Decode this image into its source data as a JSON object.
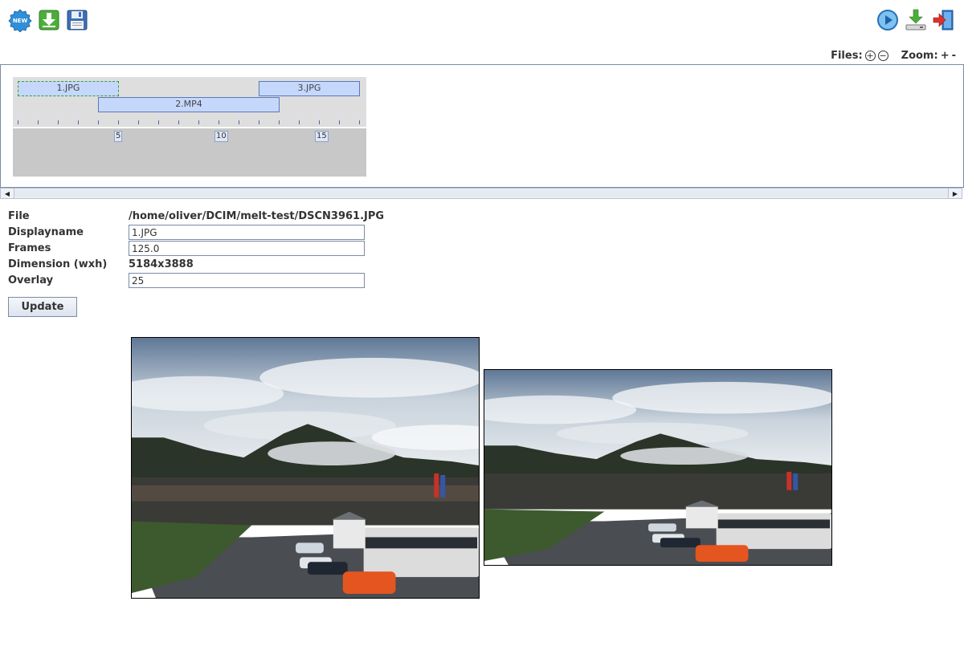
{
  "toolbar": {
    "left_icons": [
      "new-icon",
      "import-icon",
      "save-icon"
    ],
    "right_icons": [
      "play-icon",
      "download-icon",
      "exit-icon"
    ]
  },
  "controls": {
    "files_label": "Files:",
    "files_add_symbol": "+",
    "files_remove_symbol": "−",
    "zoom_label": "Zoom:",
    "zoom_in_symbol": "+",
    "zoom_out_symbol": "-"
  },
  "timeline": {
    "clips": [
      {
        "label": "1.JPG",
        "start": 0,
        "end": 5,
        "row": 0,
        "selected": true
      },
      {
        "label": "3.JPG",
        "start": 12,
        "end": 17,
        "row": 0,
        "selected": false
      },
      {
        "label": "2.MP4",
        "start": 4,
        "end": 13,
        "row": 1,
        "selected": false
      }
    ],
    "ruler_labels": [
      "5",
      "10",
      "15"
    ],
    "colors": {
      "clip_fill": "#c5d8fb",
      "clip_border": "#5a78b8",
      "selected_border": "#3a9a3a"
    }
  },
  "properties": {
    "file_label": "File",
    "file_value": "/home/oliver/DCIM/melt-test/DSCN3961.JPG",
    "displayname_label": "Displayname",
    "displayname_value": "1.JPG",
    "frames_label": "Frames",
    "frames_value": "125.0",
    "dimension_label": "Dimension (wxh)",
    "dimension_value": "5184x3888",
    "overlay_label": "Overlay",
    "overlay_value": "25",
    "update_button": "Update"
  },
  "previews": [
    {
      "name": "current-preview"
    },
    {
      "name": "next-preview"
    }
  ]
}
